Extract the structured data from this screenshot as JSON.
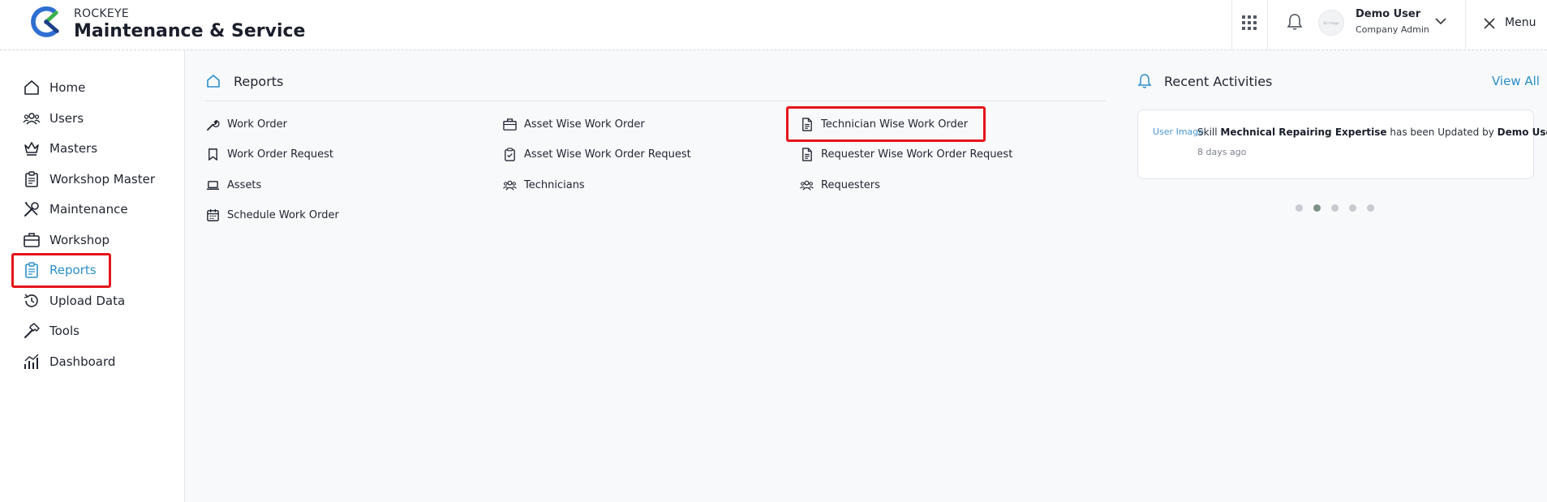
{
  "header": {
    "brand_small": "ROCKEYE",
    "brand_title": "Maintenance & Service",
    "avatar_text": "No Image",
    "user_name": "Demo User",
    "user_role": "Company Admin",
    "menu_label": "Menu"
  },
  "sidebar": {
    "items": [
      {
        "label": "Home",
        "icon": "home-icon"
      },
      {
        "label": "Users",
        "icon": "users-icon"
      },
      {
        "label": "Masters",
        "icon": "crown-icon"
      },
      {
        "label": "Workshop Master",
        "icon": "clipboard-icon"
      },
      {
        "label": "Maintenance",
        "icon": "tools-icon"
      },
      {
        "label": "Workshop",
        "icon": "briefcase-icon"
      },
      {
        "label": "Reports",
        "icon": "report-icon",
        "active": true
      },
      {
        "label": "Upload Data",
        "icon": "history-icon"
      },
      {
        "label": "Tools",
        "icon": "hammer-icon"
      },
      {
        "label": "Dashboard",
        "icon": "chart-icon"
      }
    ]
  },
  "reports": {
    "title": "Reports",
    "links": [
      {
        "label": "Work Order",
        "icon": "wrench-icon"
      },
      {
        "label": "Work Order Request",
        "icon": "bookmark-icon"
      },
      {
        "label": "Assets",
        "icon": "laptop-icon"
      },
      {
        "label": "Schedule Work Order",
        "icon": "calendar-icon"
      },
      {
        "label": "Asset Wise Work Order",
        "icon": "briefcase-icon"
      },
      {
        "label": "Asset Wise Work Order Request",
        "icon": "clipboard-check-icon"
      },
      {
        "label": "Technicians",
        "icon": "team-icon"
      },
      {
        "label": "Technician Wise Work Order",
        "icon": "document-icon"
      },
      {
        "label": "Requester Wise Work Order Request",
        "icon": "document-icon"
      },
      {
        "label": "Requesters",
        "icon": "team-icon"
      }
    ]
  },
  "recent_activities": {
    "title": "Recent Activities",
    "view_all": "View All",
    "activity": {
      "image_alt": "User Image",
      "prefix": "Skill",
      "subject": "Mechnical Repairing Expertise",
      "middle": "has been Updated by",
      "actor": "Demo User",
      "suffix": ".",
      "time": "8 days ago"
    },
    "dots": 5,
    "active_dot": 1
  },
  "colors": {
    "accent": "#2b8fc9",
    "highlight": "#e4141b"
  }
}
